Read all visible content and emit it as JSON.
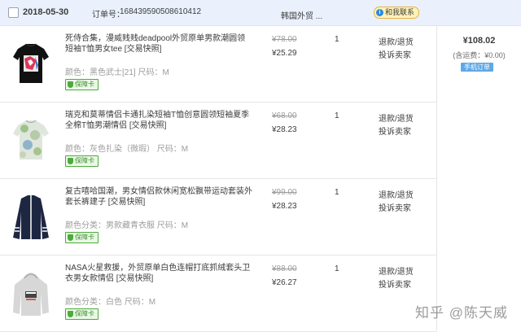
{
  "order": {
    "date": "2018-05-30",
    "order_no_label": "订单号：",
    "order_no": "168439590508610412",
    "shop": "韩国外贸 ...",
    "contact_label": "和我联系",
    "total_amount": "¥108.02",
    "shipping_note": "(含运费：¥0.00)",
    "mobile_order_label": "手机订单"
  },
  "items": [
    {
      "title": "死侍合集，漫威贱贱deadpool外贸原单男款潮圆领短袖T恤男女tee [交易快照]",
      "attrs": "颜色：黑色武士[21]  尺码：M",
      "guarantee": "保障卡",
      "old_price": "¥78.00",
      "price": "¥25.29",
      "qty": "1",
      "action1": "退款/退货",
      "action2": "投诉卖家"
    },
    {
      "title": "瑞克和莫蒂情侣卡通扎染短袖T恤创意圆领短袖夏季全棉T恤男潮情侣 [交易快照]",
      "attrs": "颜色：灰色扎染（微瑕）  尺码：M",
      "guarantee": "保障卡",
      "old_price": "¥68.00",
      "price": "¥28.23",
      "qty": "1",
      "action1": "退款/退货",
      "action2": "投诉卖家"
    },
    {
      "title": "复古嘻哈国潮，男女情侣款休闲宽松飘带运动套装外套长裤建子 [交易快照]",
      "attrs": "颜色分类：男款藏青衣服  尺码：M",
      "guarantee": "保障卡",
      "old_price": "¥99.00",
      "price": "¥28.23",
      "qty": "1",
      "action1": "退款/退货",
      "action2": "投诉卖家"
    },
    {
      "title": "NASA火星救援，外贸原单白色连帽打底抓绒套头卫衣男女款情侣 [交易快照]",
      "attrs": "颜色分类：白色  尺码：M",
      "guarantee": "保障卡",
      "old_price": "¥88.00",
      "price": "¥26.27",
      "qty": "1",
      "action1": "退款/退货",
      "action2": "投诉卖家"
    }
  ],
  "watermark": "知乎 @陈天威",
  "icons": {
    "checkbox": "checkbox-icon",
    "contact": "chat-bubble-icon",
    "guarantee": "shield-icon"
  }
}
